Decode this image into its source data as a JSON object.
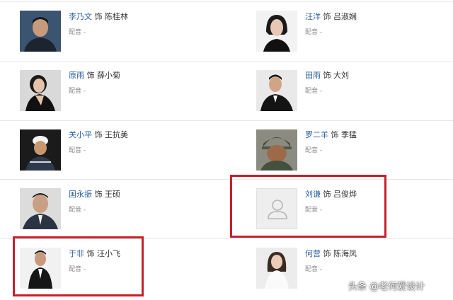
{
  "cast_list": [
    {
      "actor": "李乃文",
      "sep": "饰",
      "role": "陈桂林",
      "dubbing": "配音 -"
    },
    {
      "actor": "汪洋",
      "sep": "饰",
      "role": "吕淑娴",
      "dubbing": "配音 -"
    },
    {
      "actor": "原雨",
      "sep": "饰",
      "role": "薛小菊",
      "dubbing": "配音 -"
    },
    {
      "actor": "田雨",
      "sep": "饰",
      "role": "大刘",
      "dubbing": "配音 -"
    },
    {
      "actor": "关小平",
      "sep": "饰",
      "role": "王抗美",
      "dubbing": "配音 -"
    },
    {
      "actor": "罗二羊",
      "sep": "饰",
      "role": "季猛",
      "dubbing": "配音 -"
    },
    {
      "actor": "国永振",
      "sep": "饰",
      "role": "王硕",
      "dubbing": "配音 -"
    },
    {
      "actor": "刘谦",
      "sep": "饰",
      "role": "吕俊烨",
      "dubbing": "配音 -"
    },
    {
      "actor": "于非",
      "sep": "饰",
      "role": "汪小飞",
      "dubbing": "配音 -"
    },
    {
      "actor": "何营",
      "sep": "饰",
      "role": "陈海凤",
      "dubbing": "配音 -"
    }
  ],
  "avatar_placeholder_icon": "user-silhouette-icon",
  "highlight_color": "#c7202a",
  "actor_link_color": "#2a5e9e",
  "watermark": "头条 @老何爱设计"
}
